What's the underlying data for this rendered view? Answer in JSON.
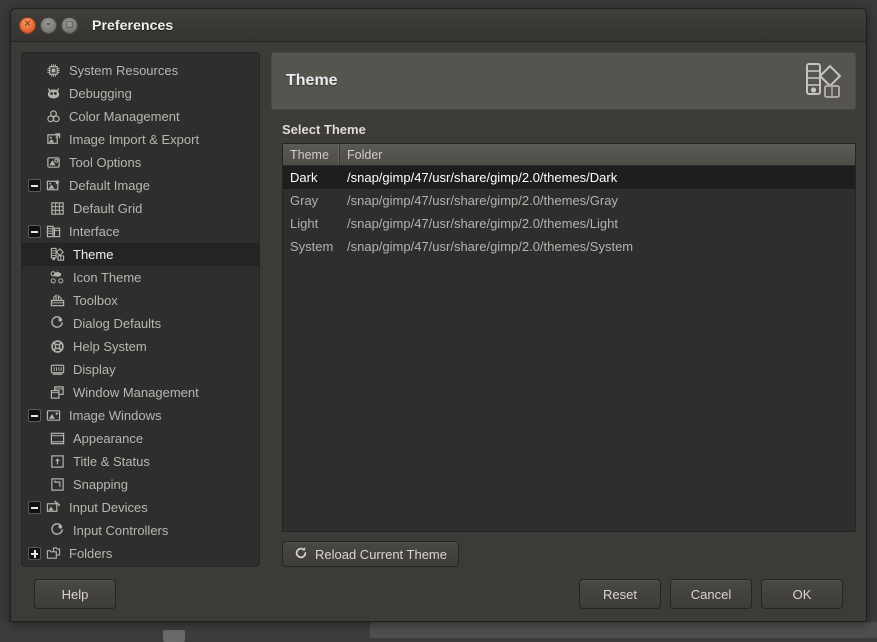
{
  "window": {
    "title": "Preferences",
    "controls": {
      "close": "close-button",
      "minimize": "minimize-button",
      "maximize": "maximize-button"
    }
  },
  "sidebar": {
    "items": [
      {
        "label": "System Resources",
        "icon": "cpu-chip-icon",
        "level": 0,
        "expander": "none",
        "selected": false
      },
      {
        "label": "Debugging",
        "icon": "wilber-face-icon",
        "level": 0,
        "expander": "none",
        "selected": false
      },
      {
        "label": "Color Management",
        "icon": "color-circles-icon",
        "level": 0,
        "expander": "none",
        "selected": false
      },
      {
        "label": "Image Import & Export",
        "icon": "import-export-icon",
        "level": 0,
        "expander": "none",
        "selected": false
      },
      {
        "label": "Tool Options",
        "icon": "tool-options-icon",
        "level": 0,
        "expander": "none",
        "selected": false
      },
      {
        "label": "Default Image",
        "icon": "default-image-icon",
        "level": 0,
        "expander": "minus",
        "selected": false
      },
      {
        "label": "Default Grid",
        "icon": "grid-icon",
        "level": 1,
        "expander": "none",
        "selected": false
      },
      {
        "label": "Interface",
        "icon": "interface-icon",
        "level": 0,
        "expander": "minus",
        "selected": false
      },
      {
        "label": "Theme",
        "icon": "theme-palette-icon",
        "level": 1,
        "expander": "none",
        "selected": true
      },
      {
        "label": "Icon Theme",
        "icon": "icon-theme-icon",
        "level": 1,
        "expander": "none",
        "selected": false
      },
      {
        "label": "Toolbox",
        "icon": "toolbox-icon",
        "level": 1,
        "expander": "none",
        "selected": false
      },
      {
        "label": "Dialog Defaults",
        "icon": "dialog-defaults-icon",
        "level": 1,
        "expander": "none",
        "selected": false
      },
      {
        "label": "Help System",
        "icon": "help-system-icon",
        "level": 1,
        "expander": "none",
        "selected": false
      },
      {
        "label": "Display",
        "icon": "display-icon",
        "level": 1,
        "expander": "none",
        "selected": false
      },
      {
        "label": "Window Management",
        "icon": "window-management-icon",
        "level": 1,
        "expander": "none",
        "selected": false
      },
      {
        "label": "Image Windows",
        "icon": "image-windows-icon",
        "level": 0,
        "expander": "minus",
        "selected": false
      },
      {
        "label": "Appearance",
        "icon": "appearance-icon",
        "level": 1,
        "expander": "none",
        "selected": false
      },
      {
        "label": "Title & Status",
        "icon": "title-status-icon",
        "level": 1,
        "expander": "none",
        "selected": false
      },
      {
        "label": "Snapping",
        "icon": "snapping-icon",
        "level": 1,
        "expander": "none",
        "selected": false
      },
      {
        "label": "Input Devices",
        "icon": "input-devices-icon",
        "level": 0,
        "expander": "minus",
        "selected": false
      },
      {
        "label": "Input Controllers",
        "icon": "input-controllers-icon",
        "level": 1,
        "expander": "none",
        "selected": false
      },
      {
        "label": "Folders",
        "icon": "folders-icon",
        "level": 0,
        "expander": "plus",
        "selected": false
      }
    ]
  },
  "panel": {
    "title": "Theme",
    "header_icon": "theme-palette-icon",
    "section_label": "Select Theme",
    "table": {
      "columns": [
        "Theme",
        "Folder"
      ],
      "rows": [
        {
          "theme": "Dark",
          "folder": "/snap/gimp/47/usr/share/gimp/2.0/themes/Dark",
          "selected": true
        },
        {
          "theme": "Gray",
          "folder": "/snap/gimp/47/usr/share/gimp/2.0/themes/Gray",
          "selected": false
        },
        {
          "theme": "Light",
          "folder": "/snap/gimp/47/usr/share/gimp/2.0/themes/Light",
          "selected": false
        },
        {
          "theme": "System",
          "folder": "/snap/gimp/47/usr/share/gimp/2.0/themes/System",
          "selected": false
        }
      ]
    },
    "reload_button": {
      "label": "Reload Current Theme",
      "icon": "refresh-icon"
    }
  },
  "footer": {
    "help": "Help",
    "reset": "Reset",
    "cancel": "Cancel",
    "ok": "OK"
  },
  "colors": {
    "accent_close": "#e8703c",
    "window_bg": "#3c3b37",
    "panel_header": "#56544f",
    "list_bg": "#2e2e2e",
    "selected_row": "#1e1e1e",
    "text": "#b9b6ae",
    "text_bright": "#ffffff"
  }
}
